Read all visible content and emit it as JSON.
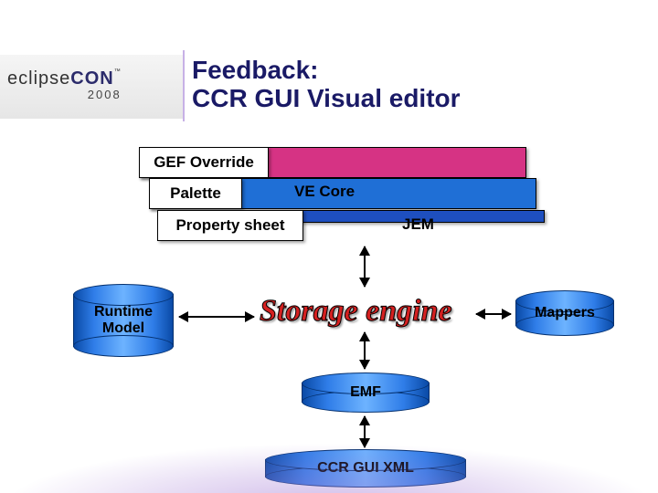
{
  "logo": {
    "part1": "eclipse",
    "part2": "CON",
    "tm": "™",
    "year": "2008"
  },
  "title": {
    "line1": "Feedback:",
    "line2": "CCR GUI Visual editor"
  },
  "boxes": {
    "gef": "GEF Override",
    "palette": "Palette",
    "vecore": "VE Core",
    "propsheet": "Property sheet",
    "jem": "JEM"
  },
  "storage": "Storage engine",
  "cylinders": {
    "runtime": "Runtime Model",
    "mappers": "Mappers",
    "emf": "EMF",
    "ccr": "CCR GUI XML"
  }
}
